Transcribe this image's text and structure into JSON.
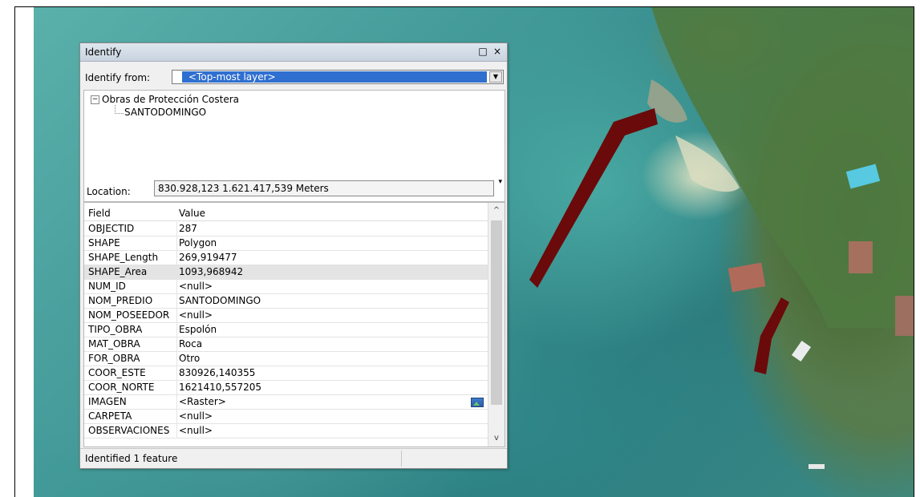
{
  "identify": {
    "title": "Identify",
    "restore_icon": "□",
    "close_icon": "×",
    "from_label": "Identify from:",
    "from_value": "<Top-most layer>",
    "tree": {
      "layer": "Obras de Protección Costera",
      "feature": "SANTODOMINGO"
    },
    "location_label": "Location:",
    "location_value": "830.928,123  1.621.417,539 Meters",
    "columns": {
      "field": "Field",
      "value": "Value"
    },
    "rows": [
      {
        "field": "OBJECTID",
        "value": "287"
      },
      {
        "field": "SHAPE",
        "value": "Polygon"
      },
      {
        "field": "SHAPE_Length",
        "value": "269,919477"
      },
      {
        "field": "SHAPE_Area",
        "value": "1093,968942"
      },
      {
        "field": "NUM_ID",
        "value": "<null>"
      },
      {
        "field": "NOM_PREDIO",
        "value": "SANTODOMINGO"
      },
      {
        "field": "NOM_POSEEDOR",
        "value": "<null>"
      },
      {
        "field": "TIPO_OBRA",
        "value": "Espolón"
      },
      {
        "field": "MAT_OBRA",
        "value": "Roca"
      },
      {
        "field": "FOR_OBRA",
        "value": "Otro"
      },
      {
        "field": "COOR_ESTE",
        "value": "830926,140355"
      },
      {
        "field": "COOR_NORTE",
        "value": "1621410,557205"
      },
      {
        "field": "IMAGEN",
        "value": "<Raster>"
      },
      {
        "field": "CARPETA",
        "value": "<null>"
      },
      {
        "field": "OBSERVACIONES",
        "value": "<null>"
      }
    ],
    "selected_row_index": 3,
    "status": "Identified 1 feature"
  },
  "map": {
    "feature_color": "#6b0a0a",
    "water_color": "#3f9796",
    "land_color": "#4d6f3a"
  }
}
